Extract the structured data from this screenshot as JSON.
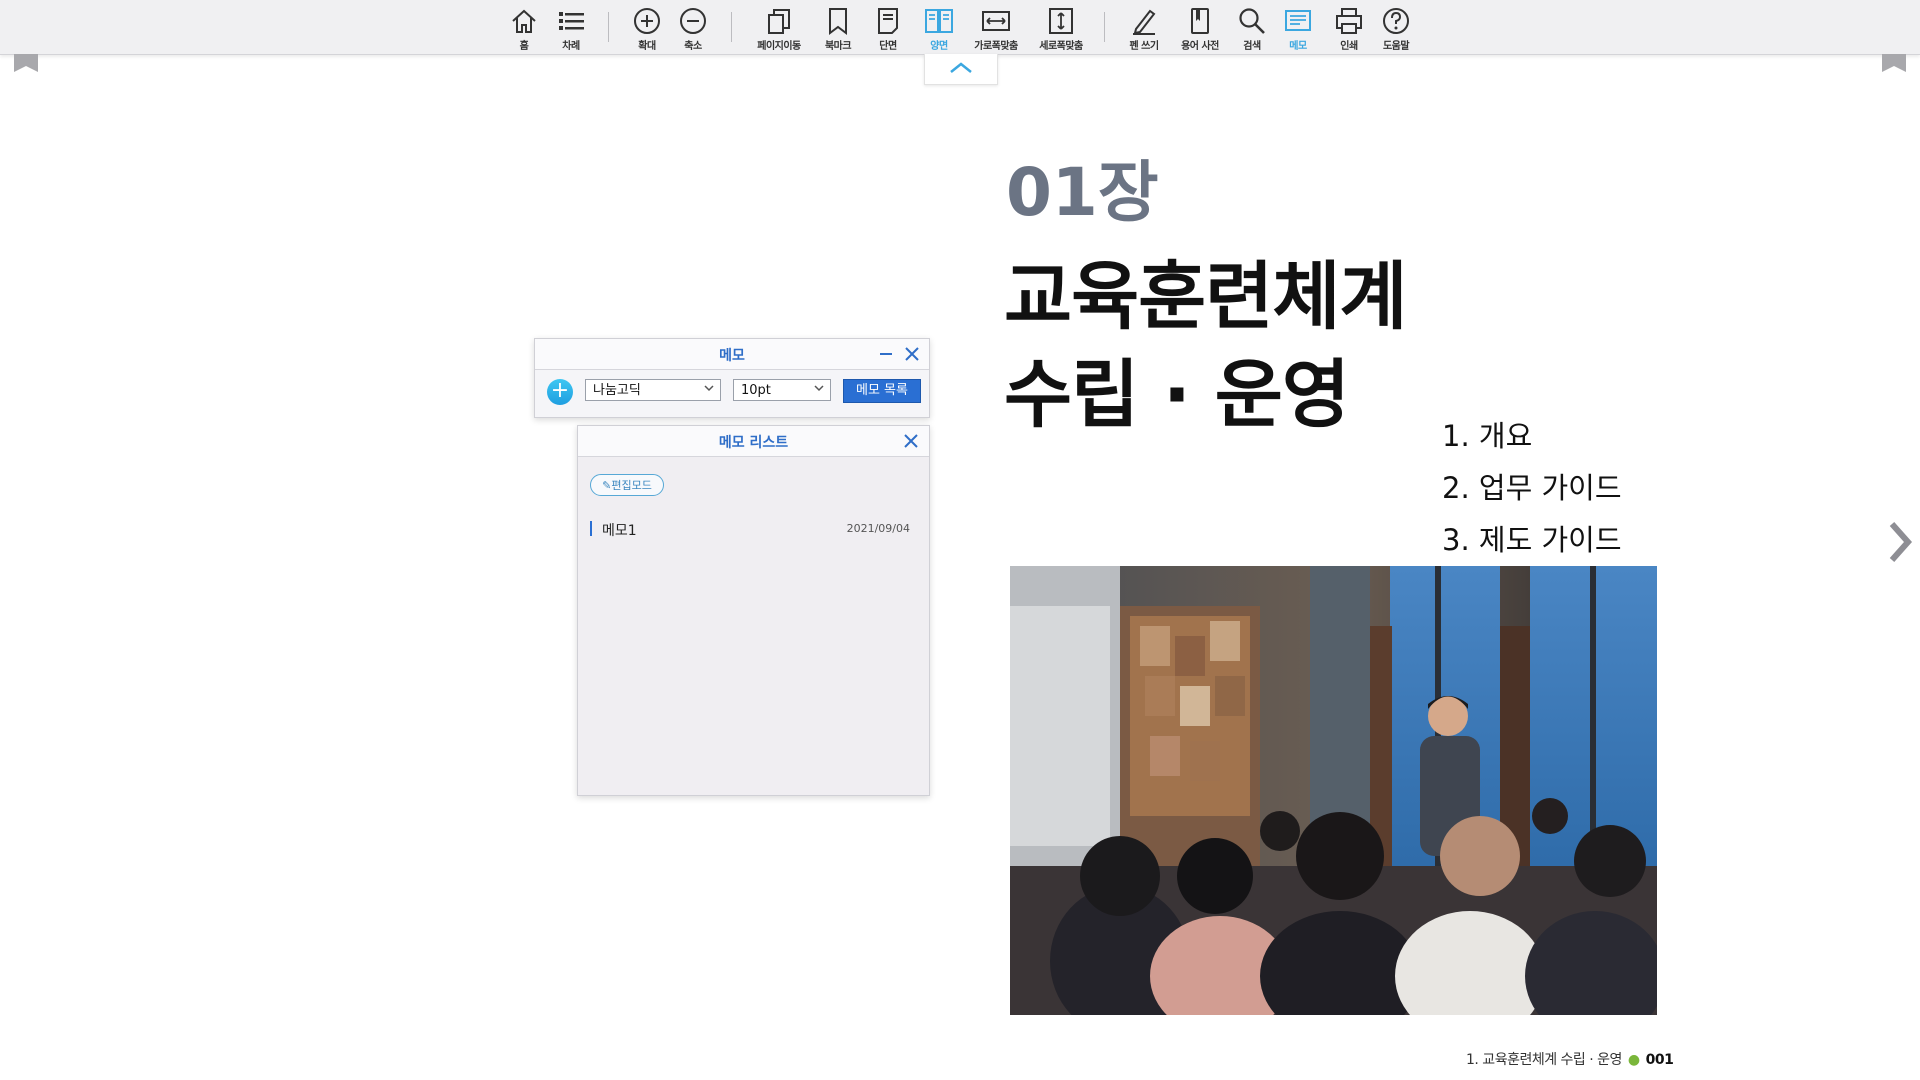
{
  "toolbar": {
    "buttons": [
      {
        "label": "홈",
        "icon": "home-icon"
      },
      {
        "label": "차례",
        "icon": "list-icon"
      },
      {
        "label": "확대",
        "icon": "zoom-in-icon"
      },
      {
        "label": "축소",
        "icon": "zoom-out-icon"
      },
      {
        "label": "페이지이동",
        "icon": "page-move-icon"
      },
      {
        "label": "북마크",
        "icon": "bookmark-icon"
      },
      {
        "label": "단면",
        "icon": "single-page-icon"
      },
      {
        "label": "양면",
        "icon": "double-page-icon",
        "active": true
      },
      {
        "label": "가로폭맞춤",
        "icon": "fit-width-icon"
      },
      {
        "label": "세로폭맞춤",
        "icon": "fit-height-icon"
      },
      {
        "label": "펜 쓰기",
        "icon": "pen-icon"
      },
      {
        "label": "용어 사전",
        "icon": "dictionary-icon"
      },
      {
        "label": "검색",
        "icon": "search-icon"
      },
      {
        "label": "메모",
        "icon": "memo-icon",
        "active": true
      },
      {
        "label": "인쇄",
        "icon": "print-icon"
      },
      {
        "label": "도움말",
        "icon": "help-icon"
      }
    ],
    "active_color": "#3ba7e0"
  },
  "page": {
    "chapter_number": "01장",
    "title_line1": "교육훈련체계",
    "title_line2": "수립 · 운영",
    "toc": [
      "1. 개요",
      "2. 업무 가이드",
      "3. 제도 가이드"
    ],
    "footer_text": "1. 교육훈련체계 수립 · 운영",
    "page_number": "001",
    "photo": "seminar-presentation-photo"
  },
  "memo_panel": {
    "title": "메모",
    "font_select": "나눔고딕",
    "size_select": "10pt",
    "list_button": "메모 목록"
  },
  "memo_list_panel": {
    "title": "메모 리스트",
    "edit_mode_label": "편집모드",
    "items": [
      {
        "name": "메모1",
        "date": "2021/09/04"
      }
    ]
  }
}
